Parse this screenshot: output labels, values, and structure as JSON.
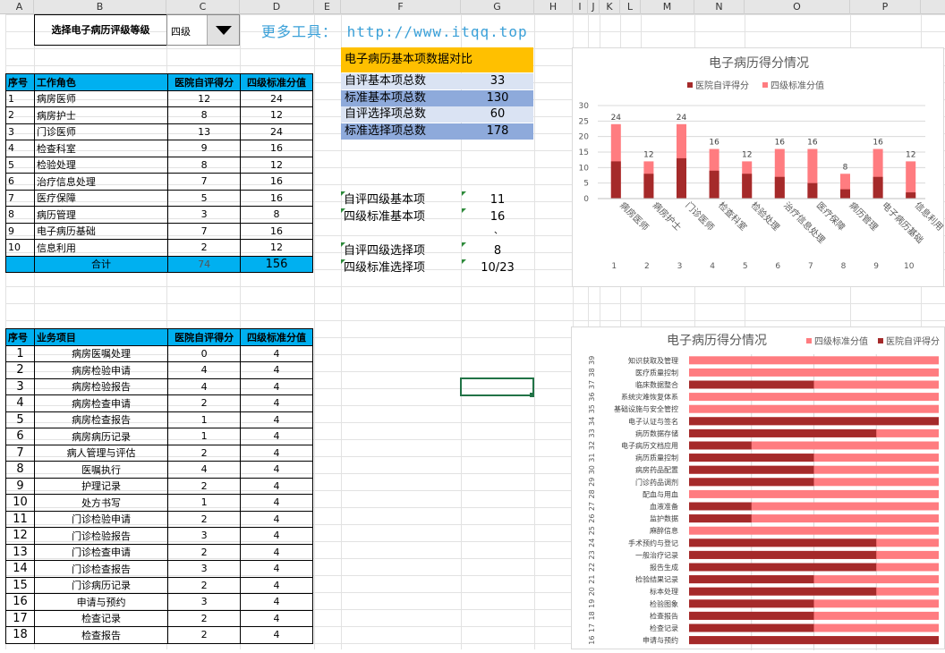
{
  "columns": [
    "A",
    "B",
    "C",
    "D",
    "E",
    "F",
    "G",
    "H",
    "I",
    "J",
    "K",
    "L",
    "M",
    "N",
    "O",
    "P"
  ],
  "selector": {
    "label": "选择电子病历评级等级",
    "value": "四级",
    "promo": "更多工具：  http://www.itqq.top"
  },
  "roles_table": {
    "headers": [
      "序号",
      "工作角色",
      "医院自评得分",
      "四级标准分值"
    ],
    "rows": [
      [
        "1",
        "病房医师",
        "12",
        "24"
      ],
      [
        "2",
        "病房护士",
        "8",
        "12"
      ],
      [
        "3",
        "门诊医师",
        "13",
        "24"
      ],
      [
        "4",
        "检查科室",
        "9",
        "16"
      ],
      [
        "5",
        "检验处理",
        "8",
        "12"
      ],
      [
        "6",
        "治疗信息处理",
        "7",
        "16"
      ],
      [
        "7",
        "医疗保障",
        "5",
        "16"
      ],
      [
        "8",
        "病历管理",
        "3",
        "8"
      ],
      [
        "9",
        "电子病历基础",
        "7",
        "16"
      ],
      [
        "10",
        "信息利用",
        "2",
        "12"
      ]
    ],
    "total_label": "合计",
    "total_self": "74",
    "total_std": "156"
  },
  "comparison": {
    "title": "电子病历基本项数据对比",
    "rows": [
      {
        "label": "自评基本项总数",
        "value": "33"
      },
      {
        "label": "标准基本项总数",
        "value": "130"
      },
      {
        "label": "自评选择项总数",
        "value": "60"
      },
      {
        "label": "标准选择项总数",
        "value": "178"
      }
    ],
    "level_rows": [
      {
        "label": "自评四级基本项",
        "value": "11"
      },
      {
        "label": "四级标准基本项",
        "value": "16"
      },
      {
        "label": "自评四级选择项",
        "value": "8"
      },
      {
        "label": "四级标准选择项",
        "value": "10/23"
      }
    ],
    "stray_mark": "、"
  },
  "items_table": {
    "headers": [
      "序号",
      "业务项目",
      "医院自评得分",
      "四级标准分值"
    ],
    "rows": [
      [
        "1",
        "病房医嘱处理",
        "0",
        "4"
      ],
      [
        "2",
        "病房检验申请",
        "4",
        "4"
      ],
      [
        "3",
        "病房检验报告",
        "4",
        "4"
      ],
      [
        "4",
        "病房检查申请",
        "2",
        "4"
      ],
      [
        "5",
        "病房检查报告",
        "1",
        "4"
      ],
      [
        "6",
        "病房病历记录",
        "1",
        "4"
      ],
      [
        "7",
        "病人管理与评估",
        "2",
        "4"
      ],
      [
        "8",
        "医嘱执行",
        "4",
        "4"
      ],
      [
        "9",
        "护理记录",
        "2",
        "4"
      ],
      [
        "10",
        "处方书写",
        "1",
        "4"
      ],
      [
        "11",
        "门诊检验申请",
        "2",
        "4"
      ],
      [
        "12",
        "门诊检验报告",
        "3",
        "4"
      ],
      [
        "13",
        "门诊检查申请",
        "2",
        "4"
      ],
      [
        "14",
        "门诊检查报告",
        "3",
        "4"
      ],
      [
        "15",
        "门诊病历记录",
        "2",
        "4"
      ],
      [
        "16",
        "申请与预约",
        "3",
        "4"
      ],
      [
        "17",
        "检查记录",
        "2",
        "4"
      ],
      [
        "18",
        "检查报告",
        "2",
        "4"
      ]
    ]
  },
  "colors": {
    "dark_red": "#a52a2a",
    "light_red": "#ff7c80",
    "header_blue": "#00b0f0",
    "header_orange": "#ffc000",
    "band_light": "#dae3f3",
    "band_dark": "#8eaadb"
  },
  "chart_data": [
    {
      "type": "bar",
      "title": "电子病历得分情况",
      "legend_position": "top",
      "categories": [
        "病房医师",
        "病房护士",
        "门诊医师",
        "检查科室",
        "检验处理",
        "治疗信息处理",
        "医疗保障",
        "病历管理",
        "电子病历基础",
        "信息利用"
      ],
      "category_numbers": [
        "1",
        "2",
        "3",
        "4",
        "5",
        "6",
        "7",
        "8",
        "9",
        "10"
      ],
      "series": [
        {
          "name": "医院自评得分",
          "values": [
            12,
            8,
            13,
            9,
            8,
            7,
            5,
            3,
            7,
            2
          ]
        },
        {
          "name": "四级标准分值",
          "values": [
            24,
            12,
            24,
            16,
            12,
            16,
            16,
            8,
            16,
            12
          ]
        }
      ],
      "ylim": [
        0,
        30
      ],
      "yticks": [
        0,
        5,
        10,
        15,
        20,
        25,
        30
      ],
      "grid": true
    },
    {
      "type": "bar",
      "orientation": "horizontal",
      "title": "电子病历得分情况",
      "legend_position": "top-right",
      "categories": [
        "申请与预约",
        "检查记录",
        "检查报告",
        "检验图象",
        "标本处理",
        "检验结果记录",
        "报告生成",
        "一般治疗记录",
        "手术预约与登记",
        "麻醉信息",
        "监护数据",
        "血液准备",
        "配血与用血",
        "门诊药品调剂",
        "病房药品配置",
        "病历质量控制",
        "电子病历文档应用",
        "病历数据存储",
        "电子认证与签名",
        "基础设施与安全管控",
        "系统灾难恢复体系",
        "临床数据整合",
        "医疗质量控制",
        "知识获取及管理"
      ],
      "category_numbers": [
        "16",
        "17",
        "18",
        "19",
        "20",
        "21",
        "22",
        "23",
        "24",
        "25",
        "26",
        "27",
        "28",
        "29",
        "30",
        "31",
        "32",
        "33",
        "34",
        "35",
        "36",
        "37",
        "38",
        "39"
      ],
      "series": [
        {
          "name": "四级标准分值",
          "values": [
            4,
            4,
            4,
            4,
            4,
            4,
            4,
            4,
            4,
            4,
            4,
            4,
            4,
            4,
            4,
            4,
            4,
            4,
            4,
            4,
            4,
            4,
            4,
            4
          ]
        },
        {
          "name": "医院自评得分",
          "values": [
            4,
            2,
            2,
            2,
            3,
            2,
            3,
            3,
            3,
            0,
            1,
            1,
            0,
            2,
            2,
            2,
            1,
            3,
            4,
            0,
            0,
            2,
            0,
            0
          ]
        }
      ],
      "xlim": [
        0,
        4
      ],
      "grid": true
    }
  ]
}
